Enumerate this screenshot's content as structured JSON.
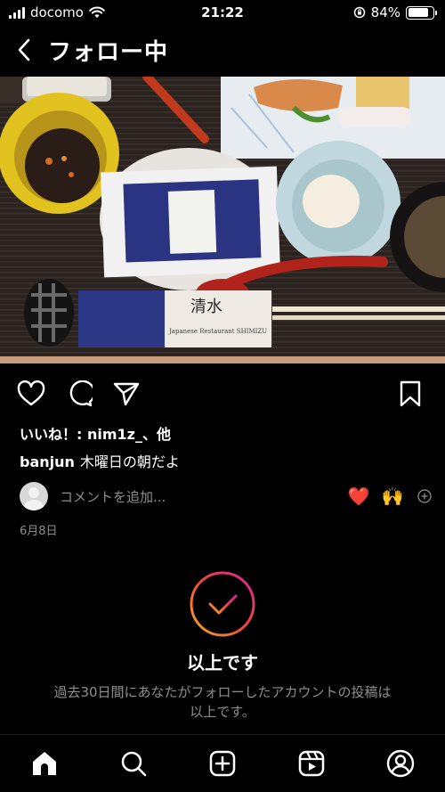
{
  "status_bar": {
    "carrier": "docomo",
    "time": "21:22",
    "battery": "84%",
    "battery_level": 0.84
  },
  "header": {
    "title": "フォロー中",
    "back_icon": "chevron-left-icon"
  },
  "post": {
    "likes_text": "いいね！: nim1z_、他",
    "username": "banjun",
    "caption": "木曜日の朝だよ",
    "comment_placeholder": "コメントを追加...",
    "quick_emojis": [
      "❤️",
      "🙌"
    ],
    "date": "6月8日",
    "photo_label": "清水",
    "photo_sublabel": "Japanese Restaurant SHIMIZU"
  },
  "caught_up": {
    "title": "以上です",
    "subtitle_line1": "過去30日間にあなたがフォローしたアカウントの投稿は",
    "subtitle_line2": "以上です。"
  },
  "nav": [
    "home-icon",
    "search-icon",
    "create-icon",
    "reels-icon",
    "profile-icon"
  ],
  "colors": {
    "background": "#000000",
    "secondary_text": "#8e8e8e",
    "gradient_start": "#f9a825",
    "gradient_end": "#d6249f"
  }
}
